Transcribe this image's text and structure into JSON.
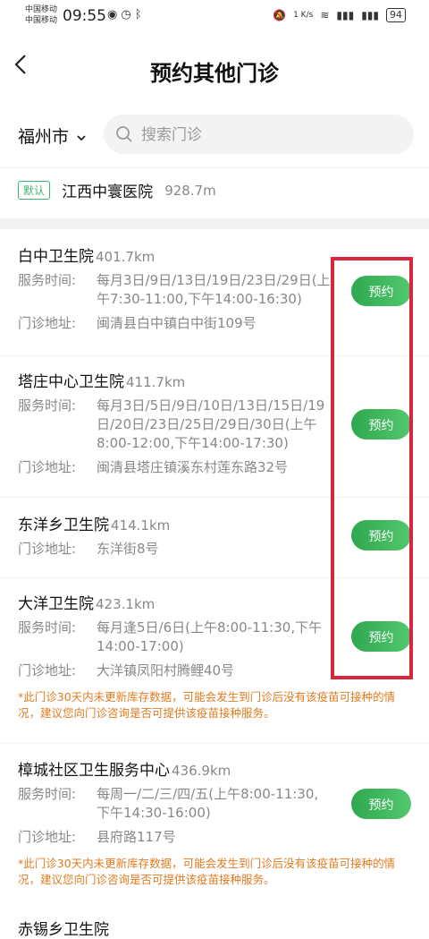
{
  "status": {
    "carrier_line1": "中国移动",
    "carrier_line2": "中国移动",
    "time": "09:55",
    "speed": "1 K/s",
    "battery": "94"
  },
  "header": {
    "title": "预约其他门诊"
  },
  "search": {
    "city": "福州市",
    "placeholder": "搜索门诊"
  },
  "default_clinic": {
    "badge": "默认",
    "name": "江西中寰医院",
    "distance": "928.7m"
  },
  "labels": {
    "service_time": "服务时间:",
    "address": "门诊地址:",
    "book": "预约"
  },
  "clinics": [
    {
      "name": "白中卫生院",
      "distance": "401.7km",
      "service_time": "每月3日/9日/13日/19日/23日/29日(上午7:30-11:00,下午14:00-16:30)",
      "address": "闽清县白中镇白中街109号"
    },
    {
      "name": "塔庄中心卫生院",
      "distance": "411.7km",
      "service_time": "每月3日/5日/9日/10日/13日/15日/19日/20日/23日/25日/29日/30日(上午8:00-12:00,下午14:00-17:30)",
      "address": "闽清县塔庄镇溪东村莲东路32号"
    },
    {
      "name": "东洋乡卫生院",
      "distance": "414.1km",
      "address": "东洋街8号"
    },
    {
      "name": "大洋卫生院",
      "distance": "423.1km",
      "service_time": "每月逢5日/6日(上午8:00-11:30,下午14:00-17:00)",
      "address": "大洋镇凤阳村腾鲤40号",
      "warning": "*此门诊30天内未更新库存数据，可能会发生到门诊后没有该疫苗可接种的情况，建议您向门诊咨询是否可提供该疫苗接种服务。"
    },
    {
      "name": "樟城社区卫生服务中心",
      "distance": "436.9km",
      "service_time": "每周一/二/三/四/五(上午8:00-11:30,下午14:30-16:00)",
      "address": "县府路117号",
      "warning": "*此门诊30天内未更新库存数据，可能会发生到门诊后没有该疫苗可接种的情况，建议您向门诊咨询是否可提供该疫苗接种服务。"
    }
  ],
  "partial_next": {
    "name": "赤锡乡卫生院"
  }
}
